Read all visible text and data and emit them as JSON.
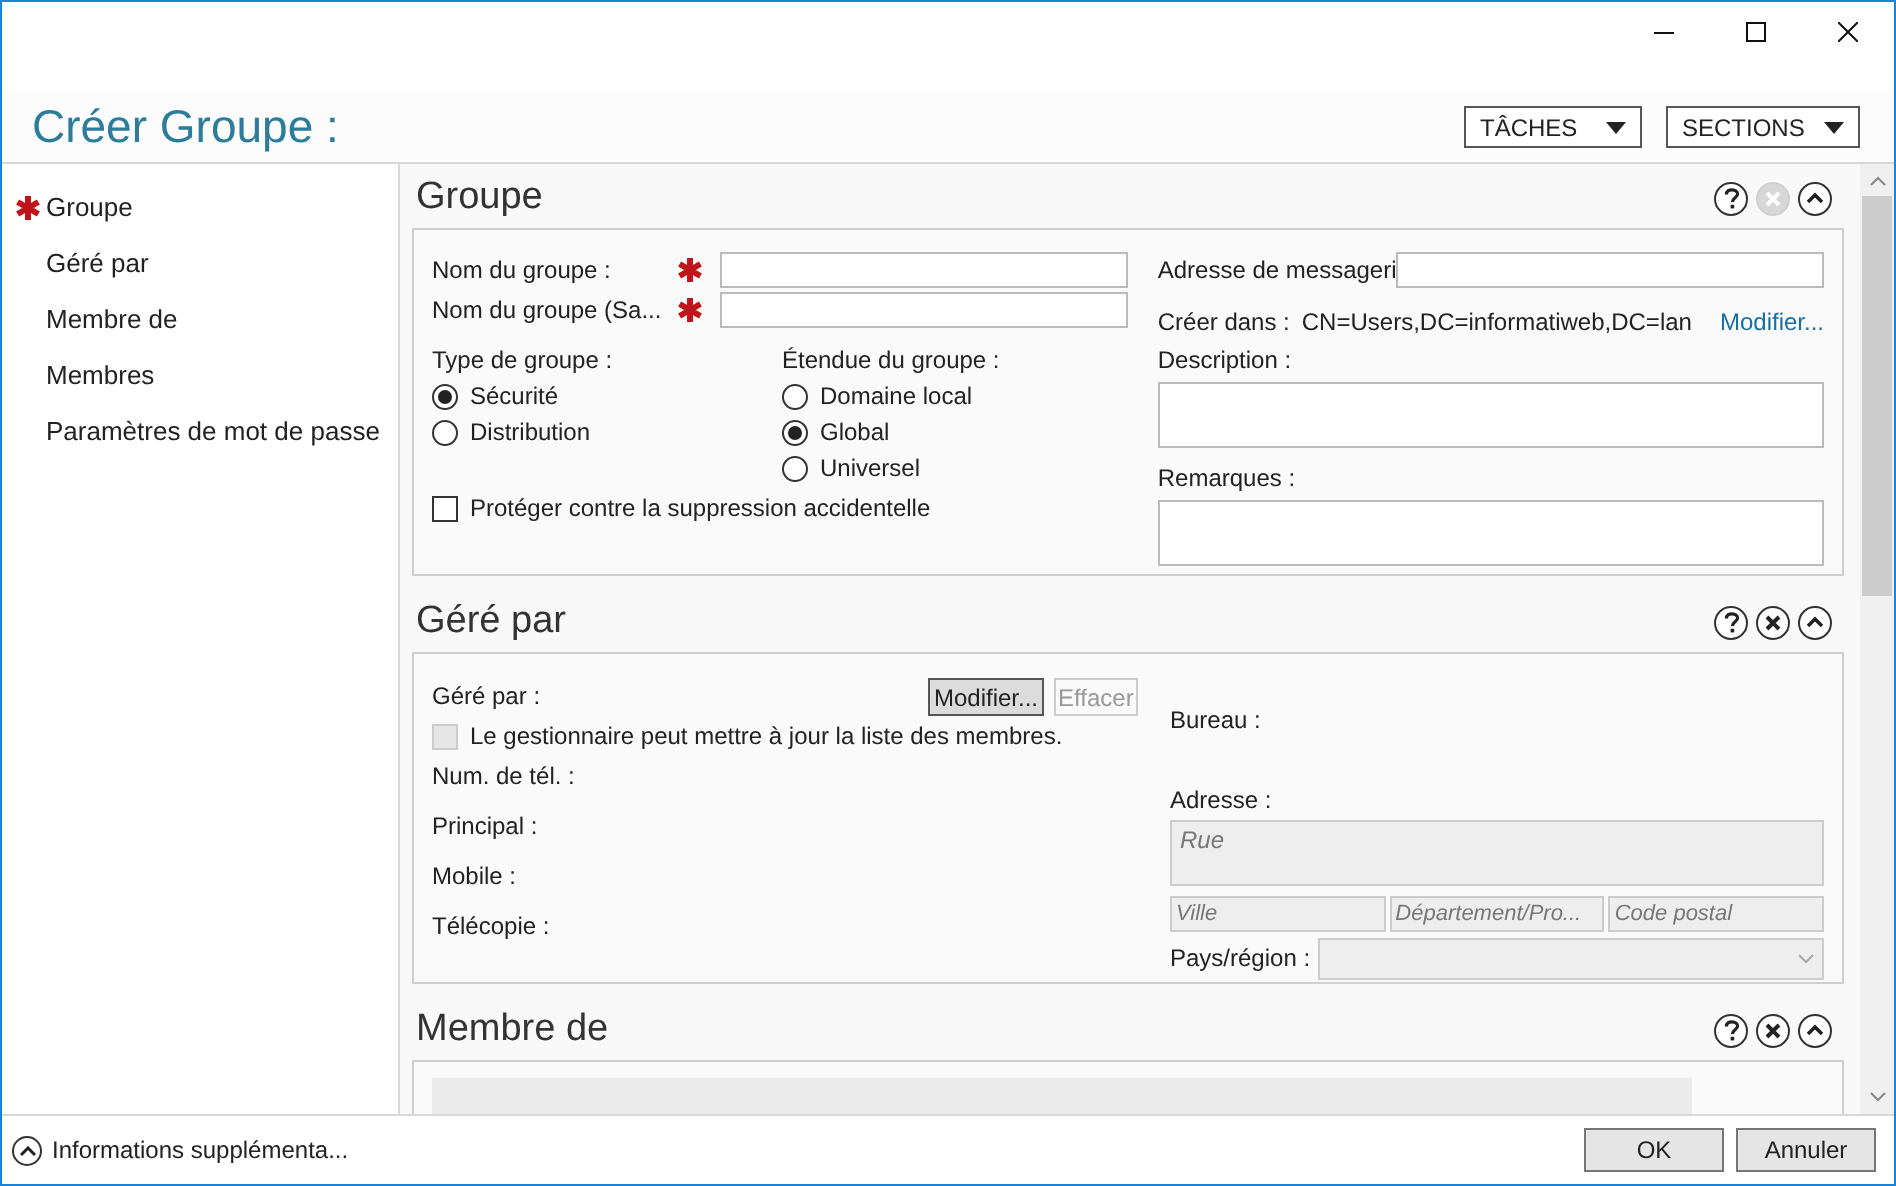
{
  "window": {
    "title": "Créer Groupe :"
  },
  "toolbar": {
    "buttons": [
      "TÂCHES",
      "SECTIONS"
    ]
  },
  "sidebar": {
    "items": [
      {
        "label": "Groupe",
        "required": true
      },
      {
        "label": "Géré par",
        "required": false
      },
      {
        "label": "Membre de",
        "required": false
      },
      {
        "label": "Membres",
        "required": false
      },
      {
        "label": "Paramètres de mot de passe",
        "required": false
      }
    ]
  },
  "groupe": {
    "title": "Groupe",
    "close_disabled": true,
    "fields": [
      {
        "label": "Nom du groupe :",
        "required": true
      },
      {
        "label": "Nom du groupe (Sa...",
        "required": true
      }
    ],
    "type": {
      "label": "Type de groupe :",
      "options": [
        {
          "label": "Sécurité",
          "selected": true
        },
        {
          "label": "Distribution",
          "selected": false
        }
      ]
    },
    "scope": {
      "label": "Étendue du groupe :",
      "options": [
        {
          "label": "Domaine local",
          "selected": false
        },
        {
          "label": "Global",
          "selected": true
        },
        {
          "label": "Universel",
          "selected": false
        }
      ]
    },
    "protect": {
      "label": "Protéger contre la suppression accidentelle",
      "checked": false
    },
    "email_label": "Adresse de messageri",
    "create_in_label": "Créer dans :",
    "create_in_value": "CN=Users,DC=informatiweb,DC=lan",
    "create_in_link": "Modifier...",
    "description_label": "Description :",
    "notes_label": "Remarques :"
  },
  "gere_par": {
    "title": "Géré par",
    "close_disabled": false,
    "managed_label": "Géré par :",
    "modify": "Modifier...",
    "clear": "Effacer",
    "manager_can_update": {
      "label": "Le gestionnaire peut mettre à jour la liste des membres.",
      "checked": false
    },
    "phone_label": "Num. de tél. :",
    "phones": [
      "Principal :",
      "Mobile :",
      "Télécopie :"
    ],
    "office_label": "Bureau :",
    "address_label": "Adresse :",
    "street_placeholder": "Rue",
    "city_placeholders": [
      "Ville",
      "Département/Pro...",
      "Code postal"
    ],
    "country_label": "Pays/région :"
  },
  "membre_de": {
    "title": "Membre de",
    "close_disabled": false
  },
  "footer": {
    "more_info": "Informations supplémenta...",
    "buttons": [
      "OK",
      "Annuler"
    ]
  }
}
